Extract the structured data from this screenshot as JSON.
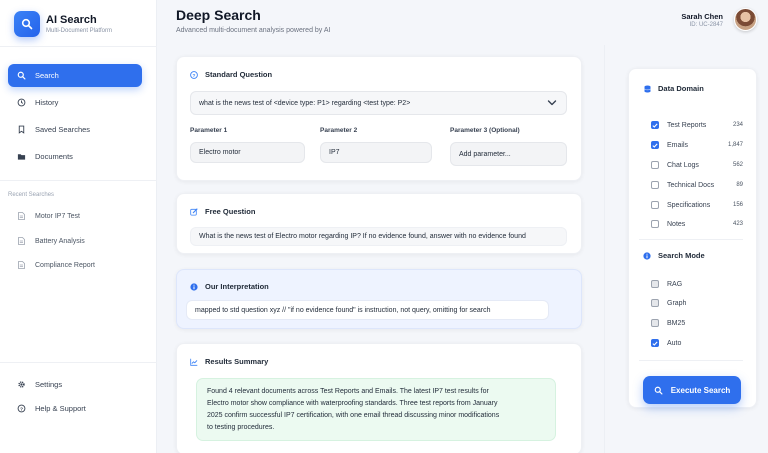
{
  "app": {
    "title": "AI Search",
    "subtitle": "Multi-Document Platform"
  },
  "nav": {
    "items": [
      {
        "label": "Search",
        "icon": "search-icon",
        "active": true
      },
      {
        "label": "History",
        "icon": "clock-icon"
      },
      {
        "label": "Saved Searches",
        "icon": "bookmark-icon"
      },
      {
        "label": "Documents",
        "icon": "folder-icon"
      }
    ],
    "recent_heading": "Recent Searches",
    "recent": [
      {
        "label": "Motor IP7 Test",
        "icon": "document-icon"
      },
      {
        "label": "Battery Analysis",
        "icon": "document-icon"
      },
      {
        "label": "Compliance Report",
        "icon": "document-icon"
      }
    ],
    "bottom": [
      {
        "label": "Settings",
        "icon": "gear-icon"
      },
      {
        "label": "Help & Support",
        "icon": "help-icon"
      }
    ]
  },
  "header": {
    "title": "Deep Search",
    "subtitle": "Advanced multi-document analysis powered by AI",
    "user_name": "Sarah Chen",
    "user_id": "ID: UC-2847"
  },
  "standard_question": {
    "heading": "Standard Question",
    "selected": "what is the news test of <device type: P1> regarding <test type: P2>",
    "params": [
      {
        "label": "Parameter 1",
        "value": "Electro motor"
      },
      {
        "label": "Parameter 2",
        "value": "IP7"
      },
      {
        "label": "Parameter 3 (Optional)",
        "value": "Add parameter..."
      }
    ]
  },
  "free_question": {
    "heading": "Free Question",
    "value": "What is the news test of Electro motor regarding IP? If no evidence found, answer with no evidence found"
  },
  "interpretation": {
    "heading": "Our Interpretation",
    "value": "mapped to std question xyz // \"if no evidence found\" is instruction, not query, omitting for search"
  },
  "results": {
    "heading": "Results Summary",
    "lines": [
      "Found 4 relevant documents across Test Reports and Emails. The latest IP7 test results for",
      "Electro motor show compliance with waterproofing standards. Three test reports from January",
      "2025 confirm successful IP7 certification, with one email thread discussing minor modifications",
      "to testing procedures."
    ]
  },
  "data_domain": {
    "heading": "Data Domain",
    "items": [
      {
        "label": "Test Reports",
        "count": "234",
        "checked": true
      },
      {
        "label": "Emails",
        "count": "1,847",
        "checked": true
      },
      {
        "label": "Chat Logs",
        "count": "562",
        "checked": false
      },
      {
        "label": "Technical Docs",
        "count": "89",
        "checked": false
      },
      {
        "label": "Specifications",
        "count": "156",
        "checked": false
      },
      {
        "label": "Notes",
        "count": "423",
        "checked": false
      }
    ]
  },
  "search_mode": {
    "heading": "Search Mode",
    "items": [
      {
        "label": "RAG",
        "checked": false
      },
      {
        "label": "Graph",
        "checked": false
      },
      {
        "label": "BM25",
        "checked": false
      },
      {
        "label": "Auto",
        "checked": true
      }
    ]
  },
  "execute_label": "Execute Search",
  "colors": {
    "accent": "#2f6fed",
    "interpretation_bg": "#eef3ff",
    "results_bg": "#ecfaf1"
  }
}
